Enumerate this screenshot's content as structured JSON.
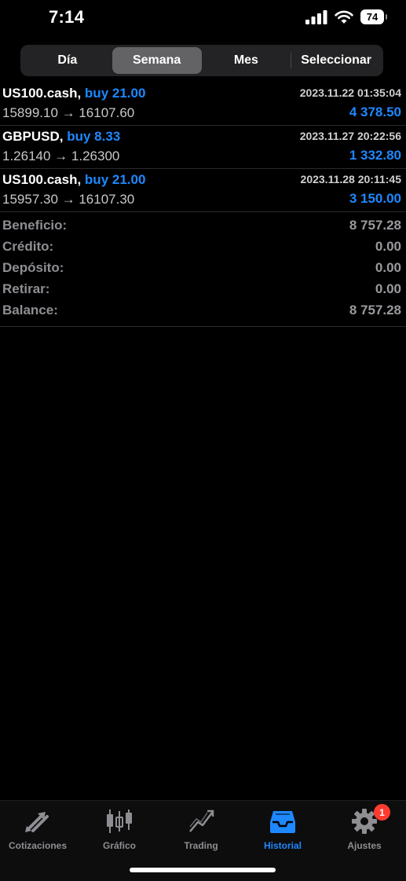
{
  "status": {
    "time": "7:14",
    "battery": "74"
  },
  "period_tabs": [
    {
      "label": "Día",
      "active": false
    },
    {
      "label": "Semana",
      "active": true
    },
    {
      "label": "Mes",
      "active": false
    },
    {
      "label": "Seleccionar",
      "active": false
    }
  ],
  "deals": [
    {
      "symbol": "US100.cash,",
      "action": "buy 21.00",
      "time": "2023.11.22 01:35:04",
      "prices": "15899.10 → 16107.60",
      "profit": "4 378.50"
    },
    {
      "symbol": "GBPUSD,",
      "action": "buy 8.33",
      "time": "2023.11.27 20:22:56",
      "prices": "1.26140 → 1.26300",
      "profit": "1 332.80"
    },
    {
      "symbol": "US100.cash,",
      "action": "buy 21.00",
      "time": "2023.11.28 20:11:45",
      "prices": "15957.30 → 16107.30",
      "profit": "3 150.00"
    }
  ],
  "summary": [
    {
      "label": "Beneficio:",
      "value": "8 757.28"
    },
    {
      "label": "Crédito:",
      "value": "0.00"
    },
    {
      "label": "Depósito:",
      "value": "0.00"
    },
    {
      "label": "Retirar:",
      "value": "0.00"
    },
    {
      "label": "Balance:",
      "value": "8 757.28"
    }
  ],
  "tabbar": [
    {
      "label": "Cotizaciones",
      "icon": "quotes-arrows-icon",
      "active": false
    },
    {
      "label": "Gráfico",
      "icon": "candlestick-chart-icon",
      "active": false
    },
    {
      "label": "Trading",
      "icon": "trading-line-chart-icon",
      "active": false
    },
    {
      "label": "Historial",
      "icon": "history-inbox-icon",
      "active": true
    },
    {
      "label": "Ajustes",
      "icon": "gear-icon",
      "active": false,
      "badge": "1"
    }
  ],
  "colors": {
    "accent": "#1e88ff",
    "background": "#000000",
    "badge": "#ff3b30",
    "muted": "#8e8e93"
  }
}
